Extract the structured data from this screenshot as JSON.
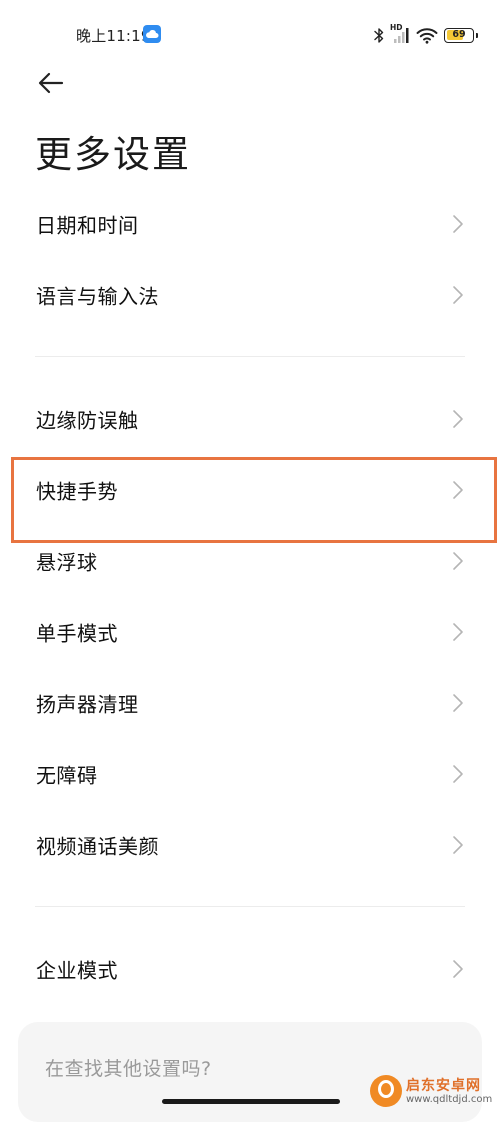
{
  "status_bar": {
    "time": "晚上11:19",
    "network_label": "HD",
    "battery_level": "69",
    "battery_percent": 69
  },
  "header": {
    "back_icon": "arrow-left-icon",
    "title": "更多设置"
  },
  "settings": {
    "group1": [
      {
        "label": "日期和时间"
      },
      {
        "label": "语言与输入法"
      }
    ],
    "group2": [
      {
        "label": "边缘防误触"
      },
      {
        "label": "快捷手势"
      },
      {
        "label": "悬浮球"
      },
      {
        "label": "单手模式"
      },
      {
        "label": "扬声器清理"
      },
      {
        "label": "无障碍"
      },
      {
        "label": "视频通话美颜"
      }
    ],
    "group3": [
      {
        "label": "企业模式"
      }
    ]
  },
  "search_card": {
    "prompt": "在查找其他设置吗?"
  },
  "highlight": {
    "color": "#e87440",
    "target": "快捷手势"
  },
  "watermark": {
    "name": "启东安卓网",
    "url": "www.qdltdjd.com"
  },
  "colors": {
    "accent": "#e87440",
    "chevron": "#b5b5b5",
    "battery": "#f3c836"
  }
}
